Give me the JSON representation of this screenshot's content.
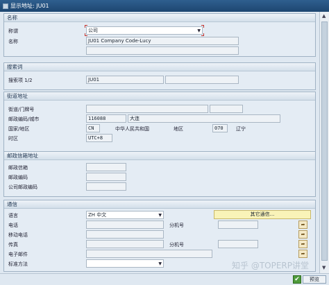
{
  "window": {
    "title": "显示地址: JU01"
  },
  "name_section": {
    "header": "名称",
    "title_label": "称谓",
    "title_value": "公司",
    "name_label": "名称",
    "name_value": "JU01 Company Code-Lucy"
  },
  "search_section": {
    "header": "搜索词",
    "term_label": "搜索项 1/2",
    "term1_value": "JU01"
  },
  "street_section": {
    "header": "街道地址",
    "street_label": "街道/门牌号",
    "postal_label": "邮政编码/城市",
    "postal_value": "116088",
    "city_value": "大连",
    "country_label": "国家/地区",
    "country_value": "CN",
    "country_name": "中华人民共和国",
    "region_label": "地区",
    "region_value": "070",
    "region_name": "辽宁",
    "timezone_label": "时区",
    "timezone_value": "UTC+8"
  },
  "pobox_section": {
    "header": "邮政信箱地址",
    "pobox_label": "邮政信箱",
    "pobox_postal_label": "邮政编码",
    "company_postal_label": "公司邮政编码"
  },
  "comm_section": {
    "header": "通信",
    "language_label": "语言",
    "language_value": "ZH 中文",
    "other_comm_button": "其它通信...",
    "phone_label": "电话",
    "ext_label": "分机号",
    "mobile_label": "移动电话",
    "fax_label": "传真",
    "fax_ext_label": "分机号",
    "email_label": "电子邮件",
    "std_method_label": "标准方法",
    "icon_glyph": "➦"
  },
  "footer": {
    "watermark": "知乎 @TOPERP讲堂",
    "confirm_icon": "✔",
    "preview_label": "预览"
  },
  "colors": {
    "titlebar": "#1d4670",
    "section_bg": "#e4ecf4",
    "highlight_button": "#f9f3b8",
    "focus_corner": "#c0302a"
  }
}
